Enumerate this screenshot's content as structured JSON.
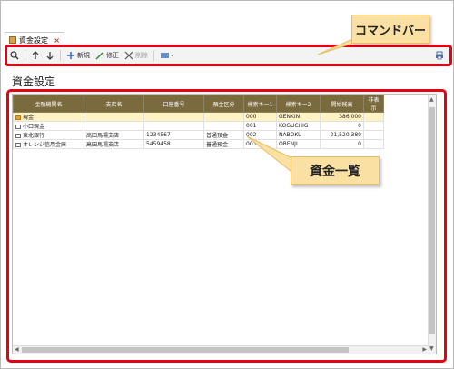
{
  "tab": {
    "label": "資金設定",
    "close": "×"
  },
  "toolbar": {
    "new_label": "新規",
    "edit_label": "修正",
    "delete_label": "削除"
  },
  "callouts": {
    "command_bar": "コマンドバー",
    "fund_list": "資金一覧"
  },
  "page": {
    "title": "資金設定"
  },
  "table": {
    "headers": [
      "金融機関名",
      "支店名",
      "口座番号",
      "預金区分",
      "検索キー1",
      "検索キー2",
      "開始残高",
      "非表示"
    ],
    "rows": [
      [
        "現金",
        "",
        "",
        "",
        "000",
        "GENKIN",
        "386,000",
        ""
      ],
      [
        "小口現金",
        "",
        "",
        "",
        "001",
        "KOGUCHIG",
        "0",
        ""
      ],
      [
        "東北銀行",
        "高田馬場支店",
        "1234567",
        "普通預金",
        "002",
        "NABOKU",
        "21,520,380",
        ""
      ],
      [
        "オレンジ信用金庫",
        "高田馬場支店",
        "5459458",
        "普通預金",
        "003",
        "ORENJI",
        "0",
        ""
      ]
    ]
  },
  "colors": {
    "accent": "#e60012",
    "header": "#7a6b3e",
    "callout": "#fbe0a4"
  }
}
